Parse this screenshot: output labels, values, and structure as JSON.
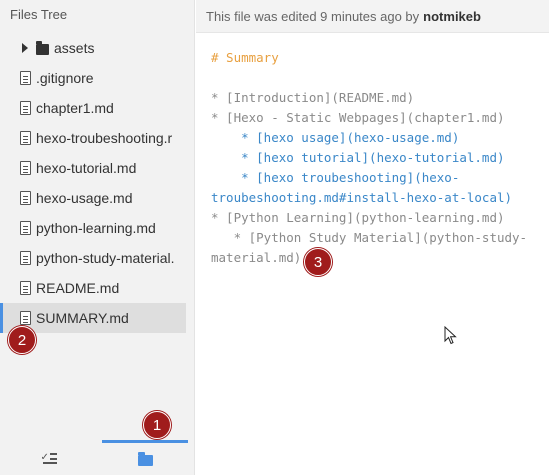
{
  "sidebar": {
    "title": "Files Tree",
    "folders": [
      {
        "label": "assets",
        "icon": "folder-icon"
      }
    ],
    "files": [
      {
        "label": ".gitignore",
        "icon": "file-icon"
      },
      {
        "label": "chapter1.md",
        "icon": "file-icon"
      },
      {
        "label": "hexo-troubeshooting.r",
        "icon": "file-icon"
      },
      {
        "label": "hexo-tutorial.md",
        "icon": "file-icon"
      },
      {
        "label": "hexo-usage.md",
        "icon": "file-icon"
      },
      {
        "label": "python-learning.md",
        "icon": "file-icon"
      },
      {
        "label": "python-study-material.",
        "icon": "file-icon"
      },
      {
        "label": "README.md",
        "icon": "file-icon"
      },
      {
        "label": "SUMMARY.md",
        "icon": "file-icon",
        "selected": true
      }
    ],
    "tabs": {
      "outline_icon": "outline-checklist-icon",
      "files_icon": "folder-icon",
      "active": "files"
    }
  },
  "main": {
    "edit_status": {
      "text": "This file was edited 9 minutes ago by",
      "author": "notmikeb"
    },
    "editor_lines": {
      "l1": "# Summary",
      "l2": "* [Introduction](README.md)",
      "l3": "* [Hexo - Static Webpages](chapter1.md)",
      "l4": "    * [hexo usage](hexo-usage.md)",
      "l5": "    * [hexo tutorial](hexo-tutorial.md)",
      "l6": "    * [hexo troubeshooting](hexo-",
      "l7": "troubeshooting.md#install-hexo-at-local)",
      "l8": "* [Python Learning](python-learning.md)",
      "l9": "   * [Python Study Material](python-study-",
      "l10": "material.md)"
    }
  },
  "annotations": {
    "badge1": "1",
    "badge2": "2",
    "badge3": "3",
    "color": "#a01c1c"
  },
  "colors": {
    "accent": "#4a90e2",
    "heading": "#e8a040",
    "link_blue": "#3a87c8",
    "code_gray": "#8a8a8a"
  }
}
